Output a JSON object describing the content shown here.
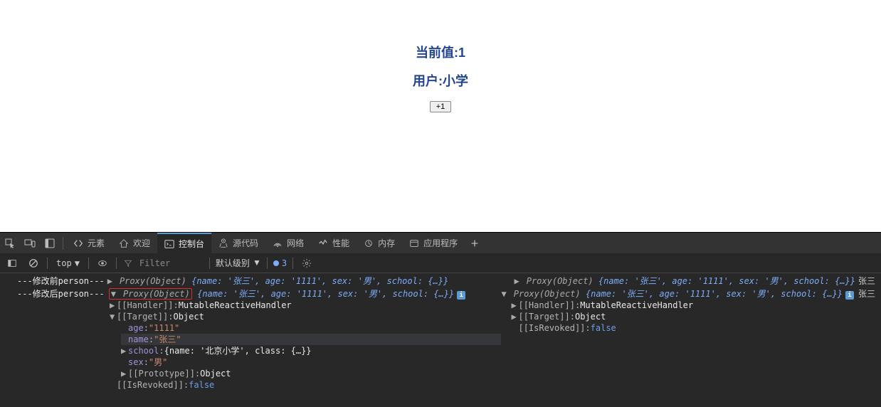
{
  "page": {
    "current_label": "当前值:",
    "current_value": "1",
    "user_label": "用户:",
    "user_value": "小学",
    "button_label": "+1"
  },
  "devtools": {
    "tabs": {
      "elements": "元素",
      "welcome": "欢迎",
      "console": "控制台",
      "sources": "源代码",
      "network": "网络",
      "performance": "性能",
      "memory": "内存",
      "application": "应用程序"
    },
    "filter": {
      "top": "top",
      "filter_placeholder": "Filter",
      "level": "默认级别",
      "issues_count": "3"
    },
    "log": {
      "source": "张三",
      "before_label": "---修改前person---",
      "after_label": "---修改后person---",
      "proxy_head": "Proxy(Object)",
      "preview": "{name: '张三', age: '1111', sex: '男', school: {…}}",
      "handler": "MutableReactiveHandler",
      "target": "Object",
      "age_value": "\"1111\"",
      "name_value": "\"张三\"",
      "school_preview": "{name: '北京小学', class: {…}}",
      "sex_value": "\"男\"",
      "isrevoked": "false"
    }
  }
}
